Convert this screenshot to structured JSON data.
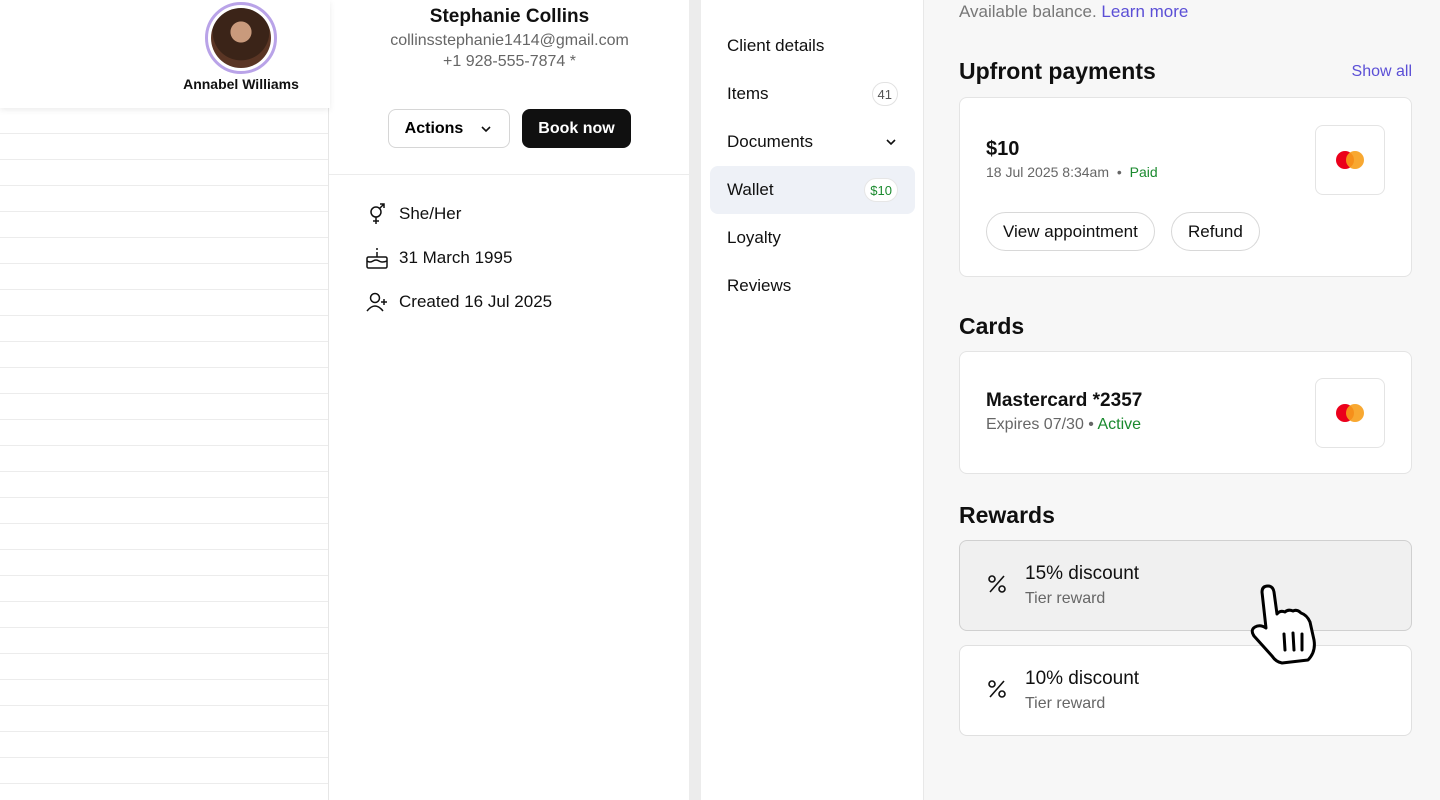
{
  "background": {
    "staff_name": "Annabel Williams"
  },
  "profile": {
    "name": "Stephanie Collins",
    "email": "collinsstephanie1414@gmail.com",
    "phone": "+1 928-555-7874 *",
    "actions_label": "Actions",
    "book_label": "Book now",
    "pronouns": "She/Her",
    "birthday": "31 March 1995",
    "created": "Created 16 Jul 2025"
  },
  "nav": {
    "items": [
      {
        "label": "Client details",
        "badge": ""
      },
      {
        "label": "Items",
        "badge": "41"
      },
      {
        "label": "Documents",
        "badge": ""
      },
      {
        "label": "Wallet",
        "badge": "$10"
      },
      {
        "label": "Loyalty",
        "badge": ""
      },
      {
        "label": "Reviews",
        "badge": ""
      }
    ]
  },
  "wallet": {
    "available_text": "Available balance.",
    "learn_more": "Learn more",
    "upfront_title": "Upfront payments",
    "show_all": "Show all",
    "payment": {
      "amount": "$10",
      "datetime": "18 Jul 2025 8:34am",
      "separator": "•",
      "status": "Paid",
      "view_label": "View appointment",
      "refund_label": "Refund"
    },
    "cards_title": "Cards",
    "card": {
      "name": "Mastercard *2357",
      "expires": "Expires 07/30",
      "separator": "•",
      "status": "Active"
    },
    "rewards_title": "Rewards",
    "rewards": [
      {
        "title": "15% discount",
        "subtitle": "Tier reward"
      },
      {
        "title": "10% discount",
        "subtitle": "Tier reward"
      }
    ]
  },
  "icons": {
    "gender": "gender-icon",
    "cake": "cake-icon",
    "user_plus": "user-plus-icon",
    "chevron": "chevron-down-icon",
    "mastercard": "mastercard-icon",
    "percent": "percent-icon",
    "cursor": "hand-pointer-icon"
  },
  "colors": {
    "accent": "#5b4fd6",
    "success": "#1a8a2e",
    "primary_button": "#101010",
    "active_nav": "#eef1f7"
  }
}
